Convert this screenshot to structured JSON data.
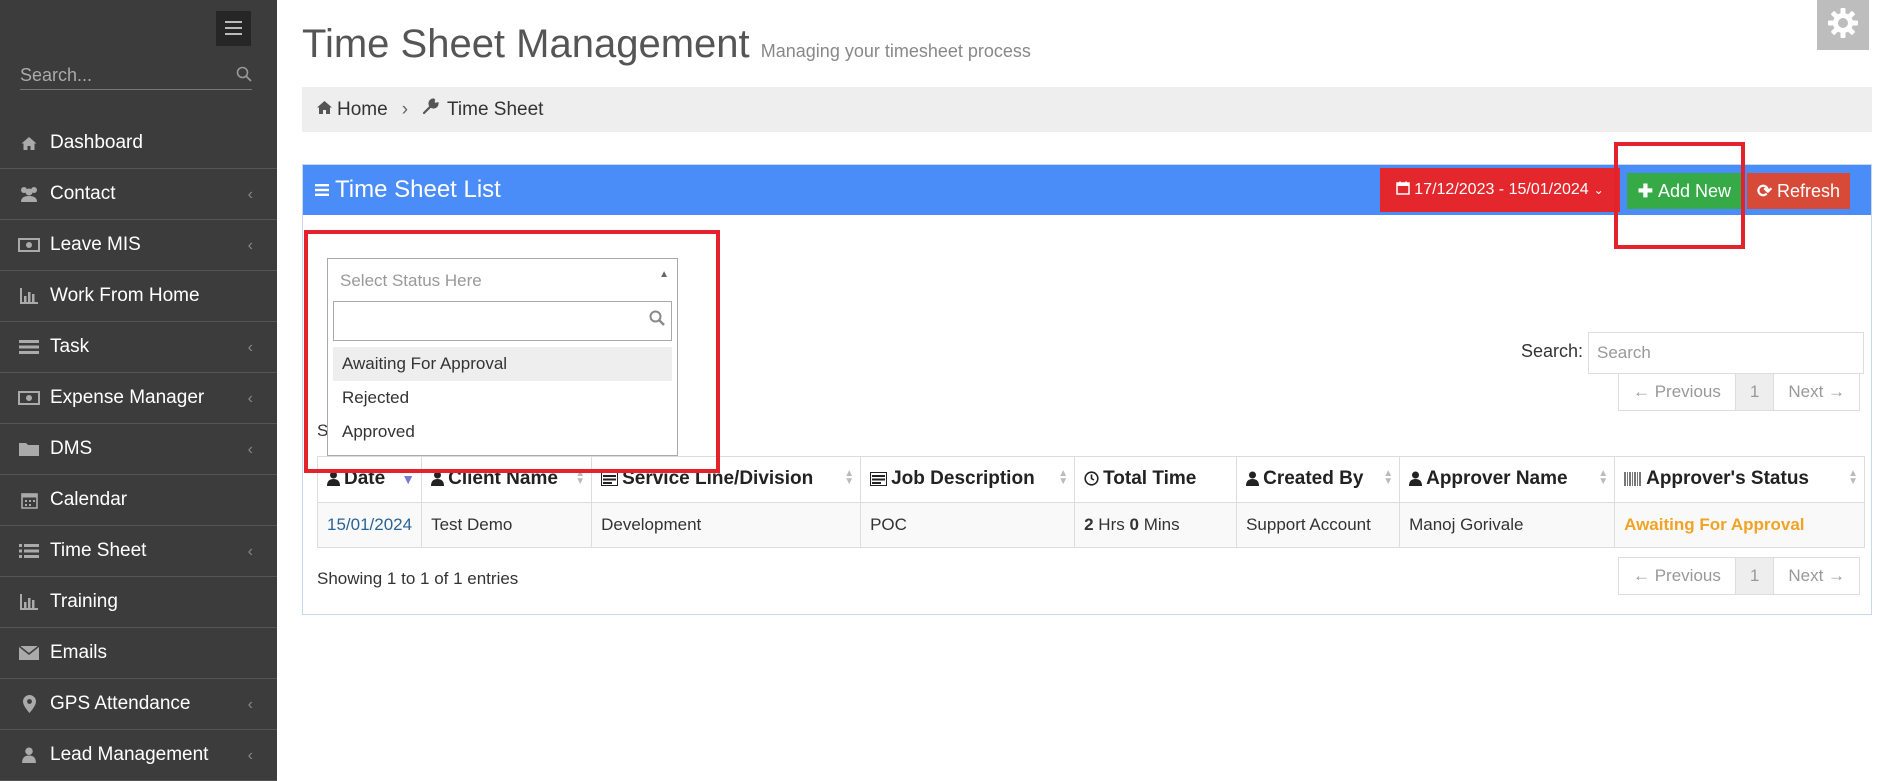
{
  "sidebar": {
    "search_placeholder": "Search...",
    "items": [
      {
        "label": "Dashboard",
        "icon": "home-icon",
        "has_submenu": false
      },
      {
        "label": "Contact",
        "icon": "users-icon",
        "has_submenu": true
      },
      {
        "label": "Leave MIS",
        "icon": "money-icon",
        "has_submenu": true
      },
      {
        "label": "Work From Home",
        "icon": "bar-chart-icon",
        "has_submenu": false
      },
      {
        "label": "Task",
        "icon": "tasks-icon",
        "has_submenu": true
      },
      {
        "label": "Expense Manager",
        "icon": "money-icon",
        "has_submenu": true
      },
      {
        "label": "DMS",
        "icon": "folder-icon",
        "has_submenu": true
      },
      {
        "label": "Calendar",
        "icon": "calendar-icon",
        "has_submenu": false
      },
      {
        "label": "Time Sheet",
        "icon": "list-icon",
        "has_submenu": true
      },
      {
        "label": "Training",
        "icon": "bar-chart-icon",
        "has_submenu": false
      },
      {
        "label": "Emails",
        "icon": "envelope-icon",
        "has_submenu": false
      },
      {
        "label": "GPS Attendance",
        "icon": "map-marker-icon",
        "has_submenu": true
      },
      {
        "label": "Lead Management",
        "icon": "user-icon",
        "has_submenu": true
      }
    ]
  },
  "header": {
    "title": "Time Sheet Management",
    "subtitle": "Managing your timesheet process"
  },
  "breadcrumb": {
    "home": "Home",
    "current": "Time Sheet"
  },
  "panel": {
    "title": "Time Sheet List",
    "date_range": "17/12/2023 - 15/01/2024",
    "add_label": "Add New",
    "refresh_label": "Refresh"
  },
  "status_filter": {
    "placeholder": "Select Status Here",
    "search_value": "",
    "options": [
      "Awaiting For Approval",
      "Rejected",
      "Approved"
    ],
    "highlighted": "Awaiting For Approval"
  },
  "table_controls": {
    "search_label": "Search:",
    "search_placeholder": "Search",
    "prev_label": "← Previous",
    "next_label": "Next →",
    "page": "1",
    "info_top_fragment": "Sh",
    "info": "Showing 1 to 1 of 1 entries"
  },
  "table": {
    "columns": [
      "Date",
      "Client Name",
      "Service Line/Division",
      "Job Description",
      "Total Time",
      "Created By",
      "Approver Name",
      "Approver's Status"
    ],
    "rows": [
      {
        "date": "15/01/2024",
        "client": "Test Demo",
        "service": "Development",
        "job": "POC",
        "hours": "2",
        "hrs_unit": "Hrs",
        "mins": "0",
        "mins_unit": "Mins",
        "created_by": "Support Account",
        "approver": "Manoj Gorivale",
        "status": "Awaiting For Approval"
      }
    ]
  },
  "colors": {
    "sidebar_bg": "#3c3c3c",
    "panel_header": "#4b8df8",
    "add_button": "#35aa47",
    "refresh_button": "#d84a38",
    "date_button": "#e4272d",
    "status_awaiting": "#f1a325",
    "highlight_box": "#e3222c"
  }
}
